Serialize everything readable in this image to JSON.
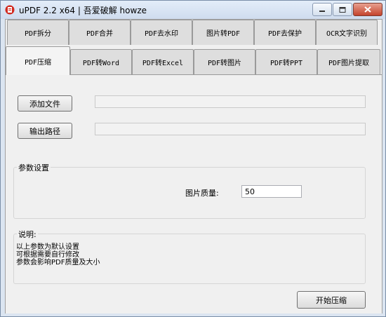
{
  "window": {
    "title": "uPDF 2.2 x64 | 吾爱破解 howze"
  },
  "tabs_row1": [
    "PDF拆分",
    "PDF合并",
    "PDF去水印",
    "图片转PDF",
    "PDF去保护",
    "OCR文字识别"
  ],
  "tabs_row2": [
    "PDF压缩",
    "PDF转Word",
    "PDF转Excel",
    "PDF转图片",
    "PDF转PPT",
    "PDF图片提取"
  ],
  "active_tab": "PDF压缩",
  "buttons": {
    "add_file": "添加文件",
    "output_path": "输出路径",
    "start": "开始压缩"
  },
  "fields": {
    "file_path": "",
    "output_path": ""
  },
  "params": {
    "group_label": "参数设置",
    "quality_label": "图片质量:",
    "quality_value": "50"
  },
  "notes": {
    "label": "说明:",
    "lines": [
      "以上参数为默认设置",
      "可根据需要自行修改",
      "参数会影响PDF质量及大小"
    ]
  }
}
